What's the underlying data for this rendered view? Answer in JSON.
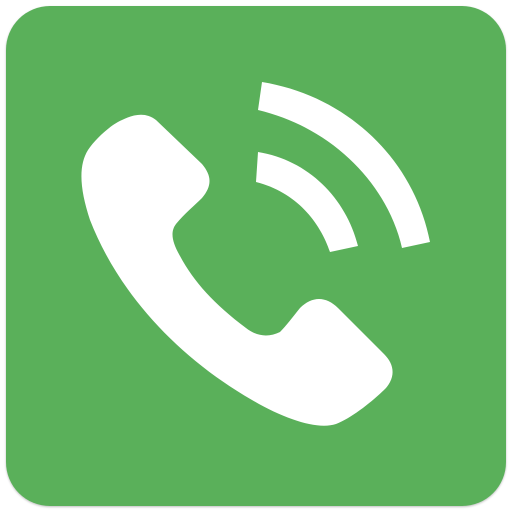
{
  "icon": {
    "name": "phone-call-icon",
    "background_color": "#5ab05a",
    "glyph_color": "#ffffff"
  }
}
